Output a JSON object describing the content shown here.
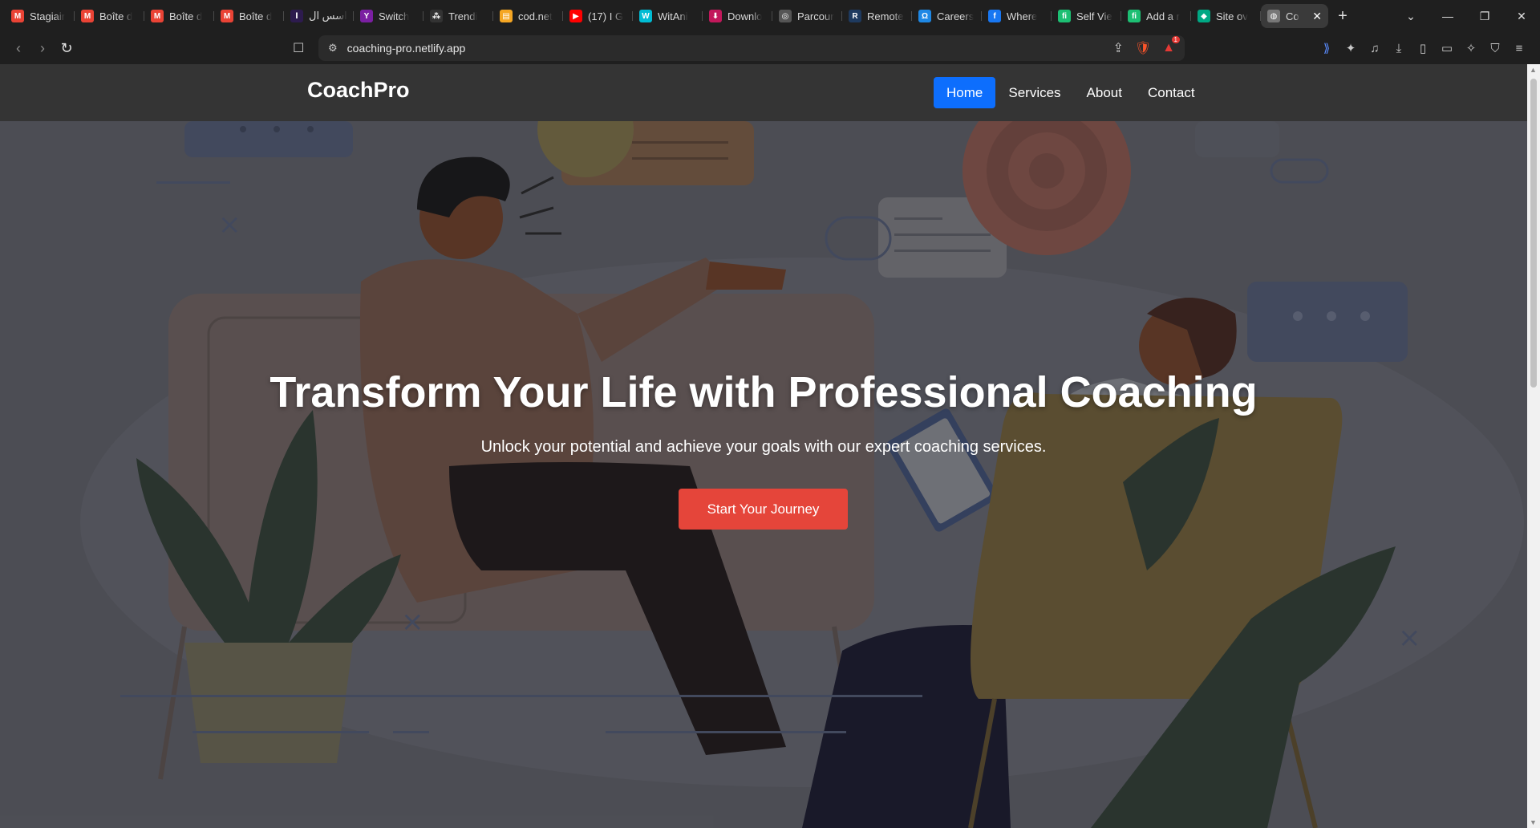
{
  "browser": {
    "tabs": [
      {
        "title": "Stagiair",
        "icon": "gmail-icon",
        "color": "#ea4335",
        "glyph": "M"
      },
      {
        "title": "Boîte d",
        "icon": "gmail-icon",
        "color": "#ea4335",
        "glyph": "M"
      },
      {
        "title": "Boîte d",
        "icon": "gmail-icon",
        "color": "#ea4335",
        "glyph": "M"
      },
      {
        "title": "Boîte d",
        "icon": "gmail-icon",
        "color": "#ea4335",
        "glyph": "M"
      },
      {
        "title": "اسس ال",
        "icon": "site-icon",
        "color": "#2d1b4e",
        "glyph": "ا"
      },
      {
        "title": "Switch",
        "icon": "yahoo-icon",
        "color": "#7b1fa2",
        "glyph": "Y"
      },
      {
        "title": "Trendi",
        "icon": "trendi-icon",
        "color": "#333333",
        "glyph": "⁂"
      },
      {
        "title": "cod.net",
        "icon": "codnet-icon",
        "color": "#f5a623",
        "glyph": "▤"
      },
      {
        "title": "(17) I G",
        "icon": "youtube-icon",
        "color": "#ff0000",
        "glyph": "▶"
      },
      {
        "title": "WitAni",
        "icon": "witani-icon",
        "color": "#00bcd4",
        "glyph": "W"
      },
      {
        "title": "Downlo",
        "icon": "download-site-icon",
        "color": "#c2185b",
        "glyph": "⬇"
      },
      {
        "title": "Parcour",
        "icon": "openai-icon",
        "color": "#555555",
        "glyph": "◎"
      },
      {
        "title": "Remote",
        "icon": "remote-icon",
        "color": "#1e3a5f",
        "glyph": "R"
      },
      {
        "title": "Careers",
        "icon": "careers-icon",
        "color": "#1e88e5",
        "glyph": "Ω"
      },
      {
        "title": "Where",
        "icon": "facebook-icon",
        "color": "#1877f2",
        "glyph": "f"
      },
      {
        "title": "Self Vie",
        "icon": "fiverr-icon",
        "color": "#1dbf73",
        "glyph": "fi"
      },
      {
        "title": "Add a r",
        "icon": "fiverr-icon",
        "color": "#1dbf73",
        "glyph": "fi"
      },
      {
        "title": "Site ov",
        "icon": "diamond-icon",
        "color": "#00a884",
        "glyph": "◆"
      },
      {
        "title": "Co",
        "icon": "globe-icon",
        "color": "#777777",
        "glyph": "◍"
      }
    ],
    "url": "coaching-pro.netlify.app",
    "notification_count": "1"
  },
  "site": {
    "brand": "CoachPro",
    "nav": [
      "Home",
      "Services",
      "About",
      "Contact"
    ],
    "active_nav": "Home",
    "hero_title": "Transform Your Life with Professional Coaching",
    "hero_subtitle": "Unlock your potential and achieve your goals with our expert coaching services.",
    "cta": "Start Your Journey"
  },
  "colors": {
    "nav_bg": "#343434",
    "active_link": "#0d6efd",
    "cta": "#e5453a"
  }
}
